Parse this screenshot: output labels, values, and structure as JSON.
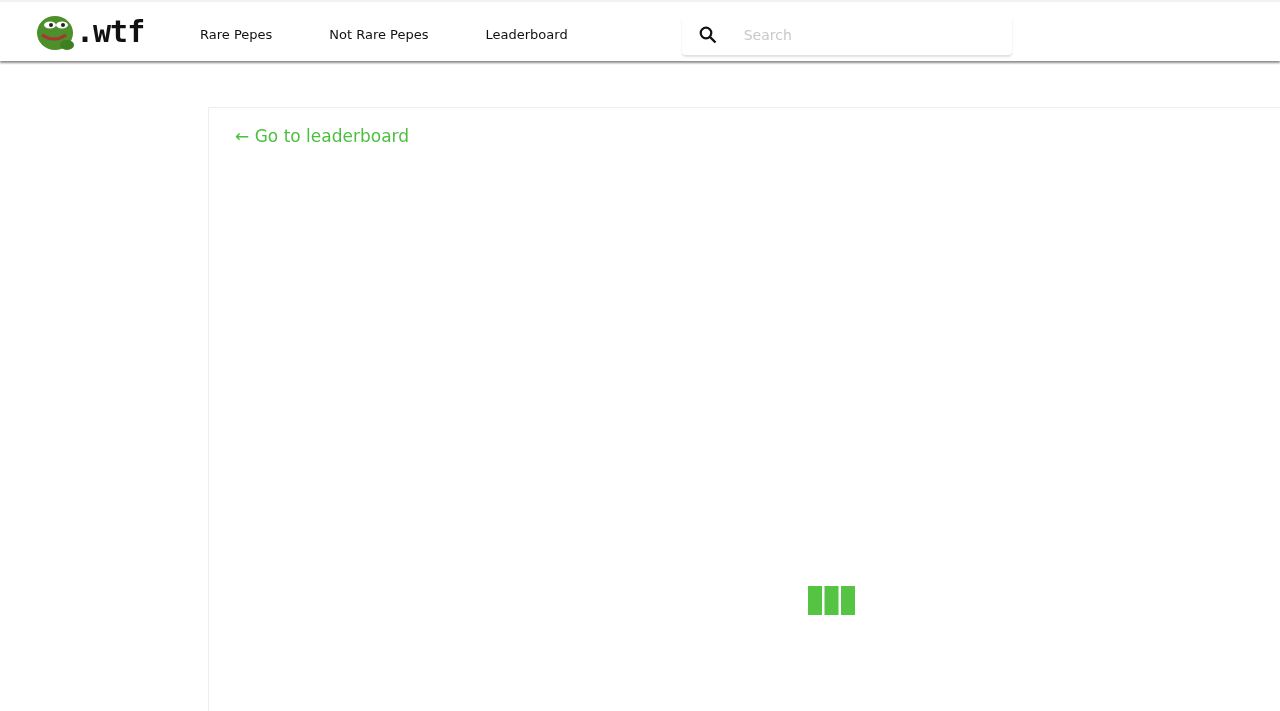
{
  "header": {
    "logo_text": ".wtf",
    "nav": [
      {
        "label": "Rare Pepes"
      },
      {
        "label": "Not Rare Pepes"
      },
      {
        "label": "Leaderboard"
      }
    ],
    "search": {
      "placeholder": "Search"
    }
  },
  "panel": {
    "back_link": "← Go to leaderboard"
  }
}
